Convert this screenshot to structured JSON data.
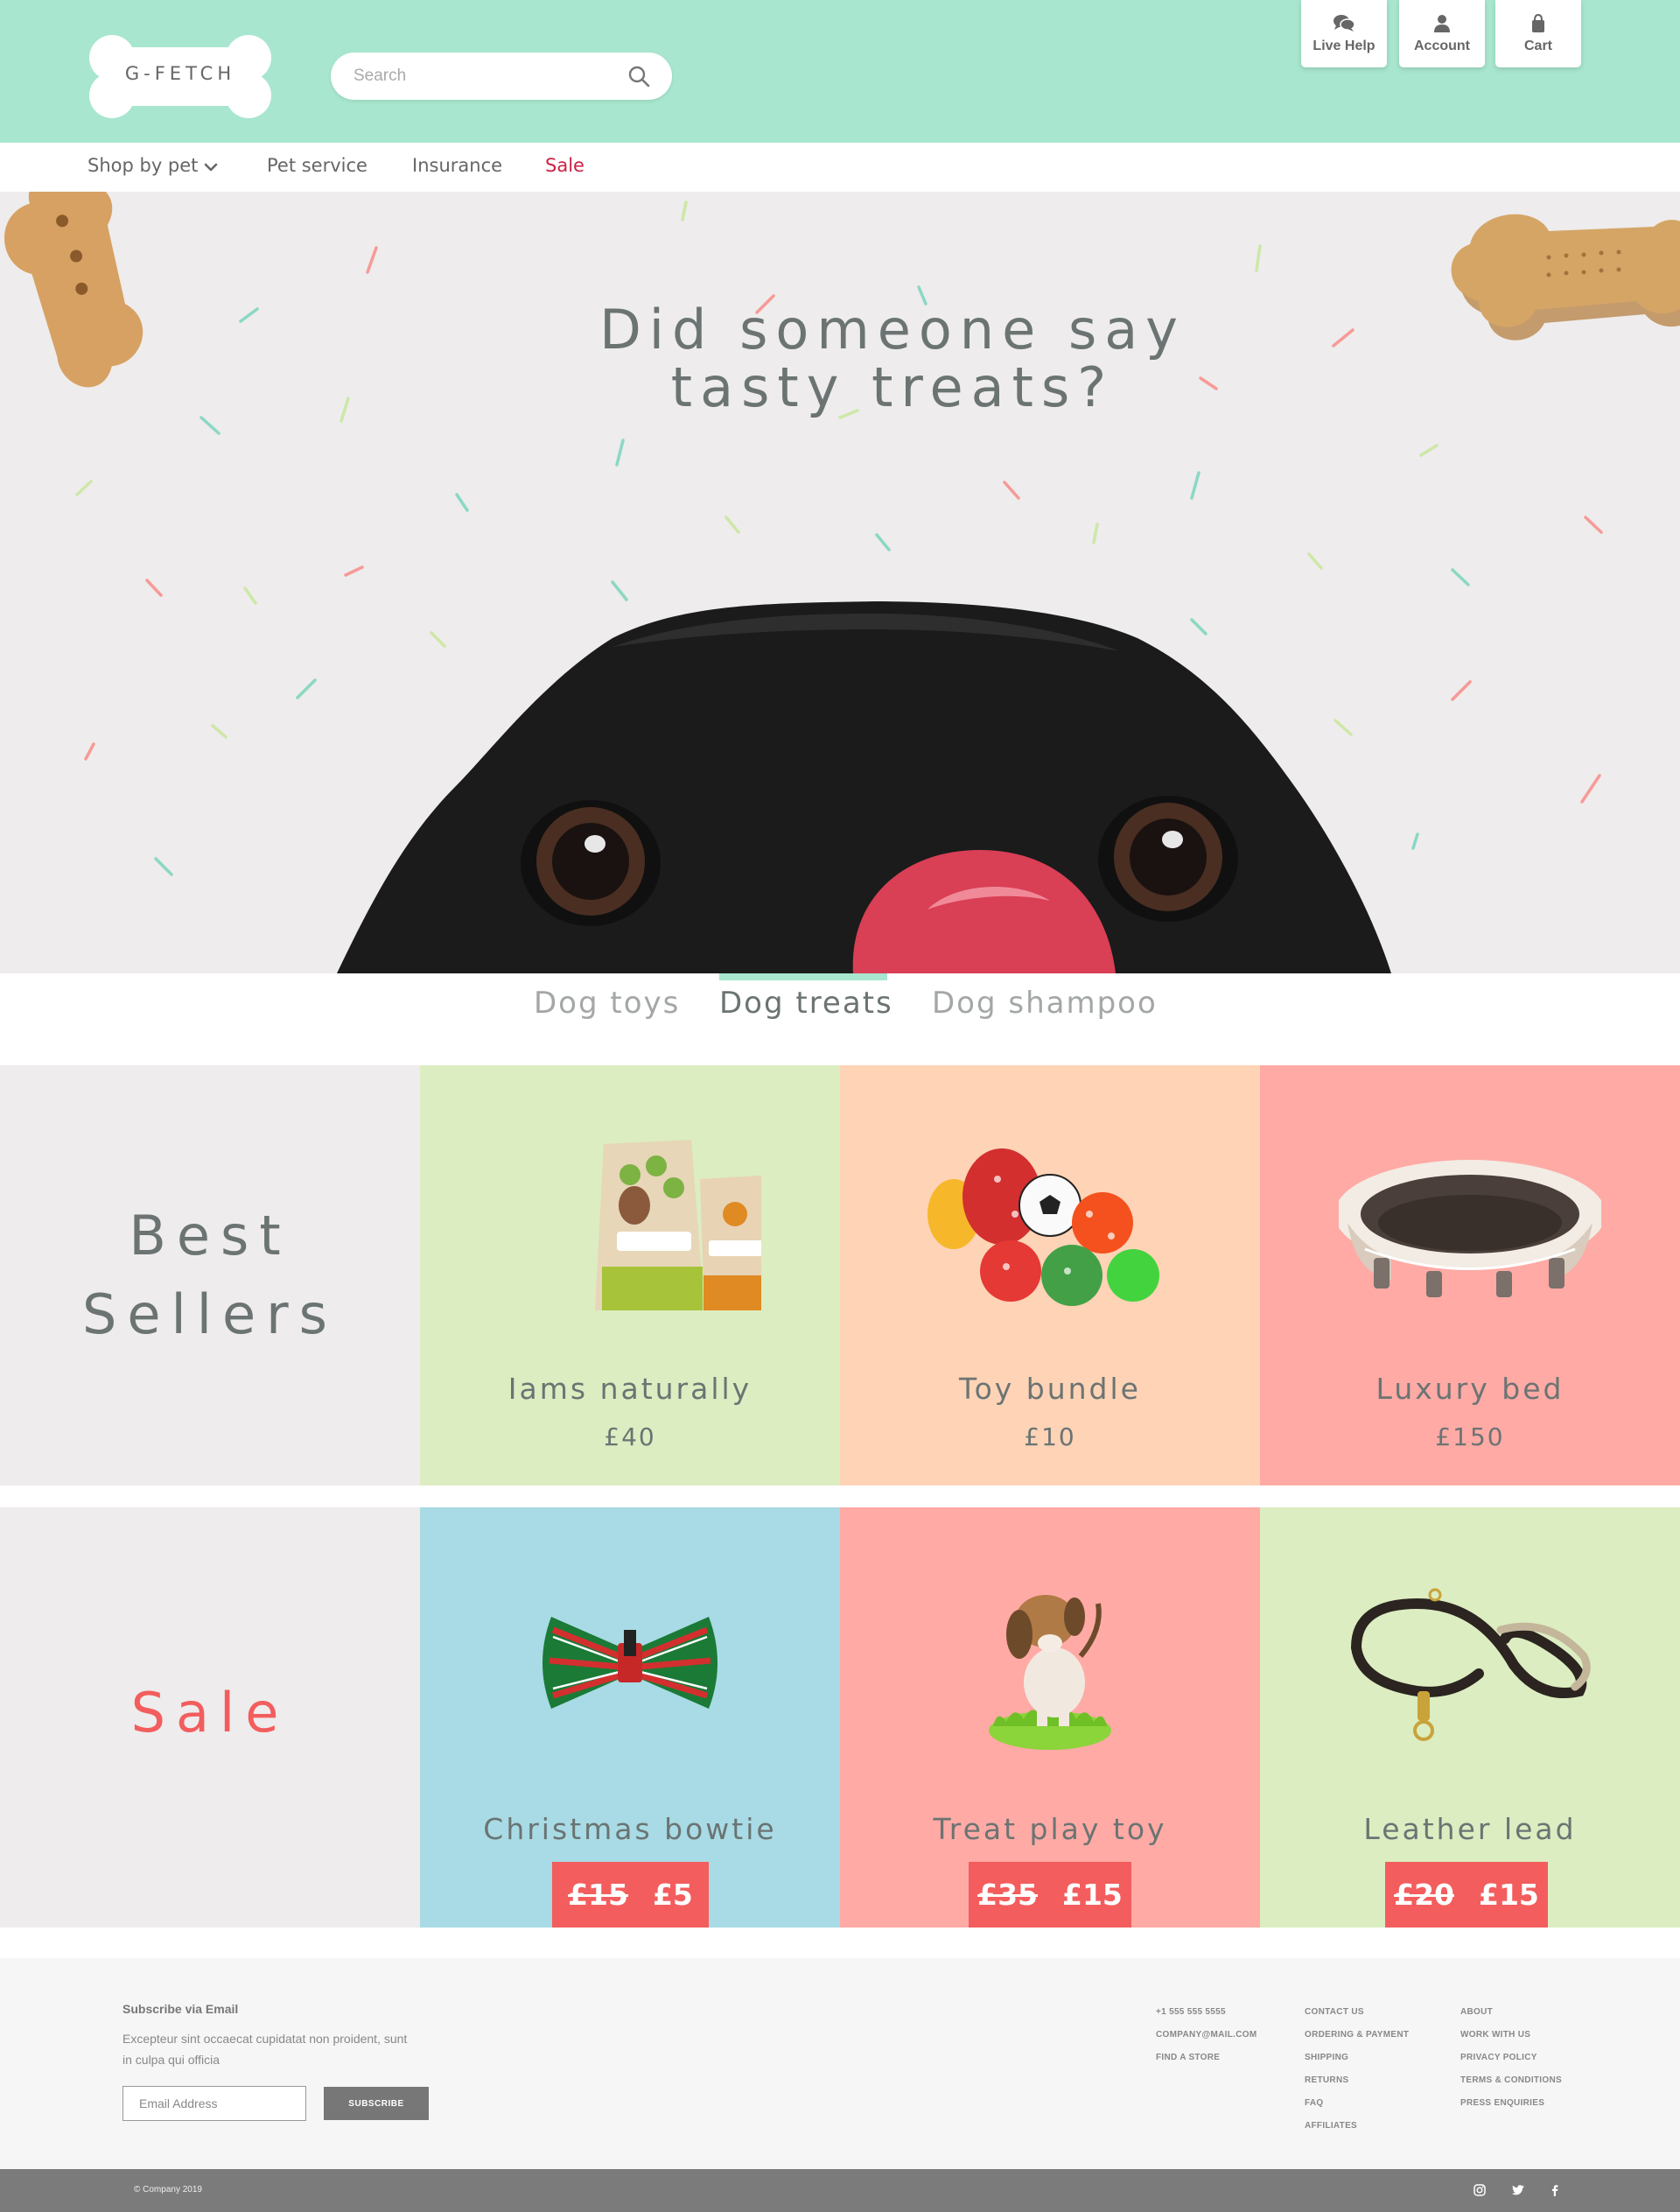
{
  "header": {
    "logo_text": "G-FETCH",
    "search_placeholder": "Search",
    "buttons": [
      {
        "label": "Live Help",
        "icon": "chat-icon"
      },
      {
        "label": "Account",
        "icon": "person-icon"
      },
      {
        "label": "Cart",
        "icon": "bag-icon"
      }
    ]
  },
  "nav": {
    "items": [
      {
        "label": "Shop by pet"
      },
      {
        "label": "Pet service"
      },
      {
        "label": "Insurance"
      },
      {
        "label": "Sale"
      }
    ]
  },
  "hero": {
    "title_line1": "Did someone say",
    "title_line2": "tasty treats?"
  },
  "tabs": [
    {
      "label": "Dog toys",
      "active": false
    },
    {
      "label": "Dog treats",
      "active": true
    },
    {
      "label": "Dog shampoo",
      "active": false
    }
  ],
  "best_sellers": {
    "title_line1": "Best",
    "title_line2": "Sellers",
    "products": [
      {
        "name": "Iams naturally",
        "price": "£40",
        "color": "#dcedc1"
      },
      {
        "name": "Toy bundle",
        "price": "£10",
        "color": "#ffd3b6"
      },
      {
        "name": "Luxury bed",
        "price": "£150",
        "color": "#ffaaa5"
      }
    ]
  },
  "sale": {
    "title": "Sale",
    "products": [
      {
        "name": "Christmas bowtie",
        "old_price": "£15",
        "new_price": "£5",
        "color": "#a8dbe5"
      },
      {
        "name": "Treat play toy",
        "old_price": "£35",
        "new_price": "£15",
        "color": "#ffaaa5"
      },
      {
        "name": "Leather lead",
        "old_price": "£20",
        "new_price": "£15",
        "color": "#dcedc1"
      }
    ]
  },
  "footer": {
    "subscribe_title": "Subscribe via Email",
    "subscribe_text": "Excepteur sint occaecat cupidatat non proident, sunt in culpa qui officia",
    "email_placeholder": "Email Address",
    "subscribe_button": "SUBSCRIBE",
    "contact": [
      "+1 555 555 5555",
      "COMPANY@MAIL.COM",
      "FIND A STORE"
    ],
    "help_links": [
      "CONTACT US",
      "ORDERING & PAYMENT",
      "SHIPPING",
      "RETURNS",
      "FAQ",
      "AFFILIATES"
    ],
    "about_links": [
      "ABOUT",
      "WORK WITH US",
      "PRIVACY POLICY",
      "TERMS & CONDITIONS",
      "PRESS ENQUIRIES"
    ],
    "copyright": "© Company 2019",
    "social_icons": [
      "instagram-icon",
      "twitter-icon",
      "facebook-icon"
    ]
  }
}
